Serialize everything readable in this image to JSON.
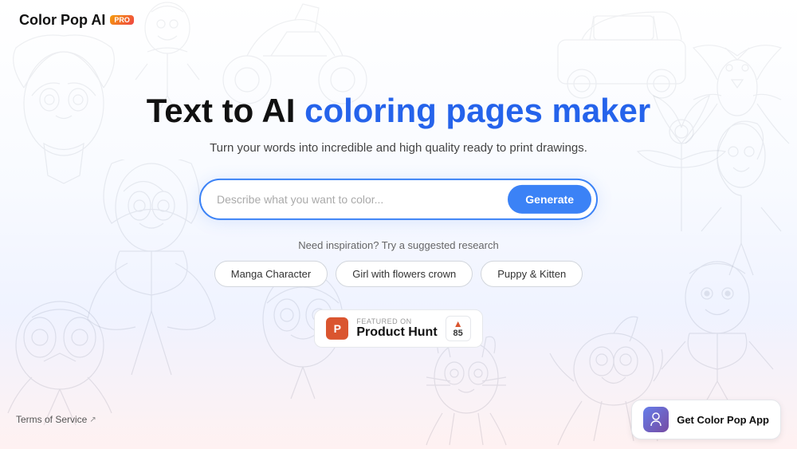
{
  "app": {
    "name": "Color Pop AI",
    "pro_badge": "PRO"
  },
  "header": {
    "logo_text": "Color Pop AI",
    "pro_label": "PRO"
  },
  "hero": {
    "headline_part1": "Text to AI ",
    "headline_part2": "coloring pages maker",
    "subtitle": "Turn your words into incredible and high quality ready to print drawings.",
    "search_placeholder": "Describe what you want to color...",
    "generate_button": "Generate",
    "suggestion_label": "Need inspiration? Try a suggested research",
    "tags": [
      "Manga Character",
      "Girl with flowers crown",
      "Puppy & Kitten"
    ]
  },
  "product_hunt": {
    "featured_on": "FEATURED ON",
    "name": "Product Hunt",
    "upvote_count": "85"
  },
  "footer": {
    "terms_text": "Terms of Service",
    "get_app_text": "Get Color Pop App"
  }
}
